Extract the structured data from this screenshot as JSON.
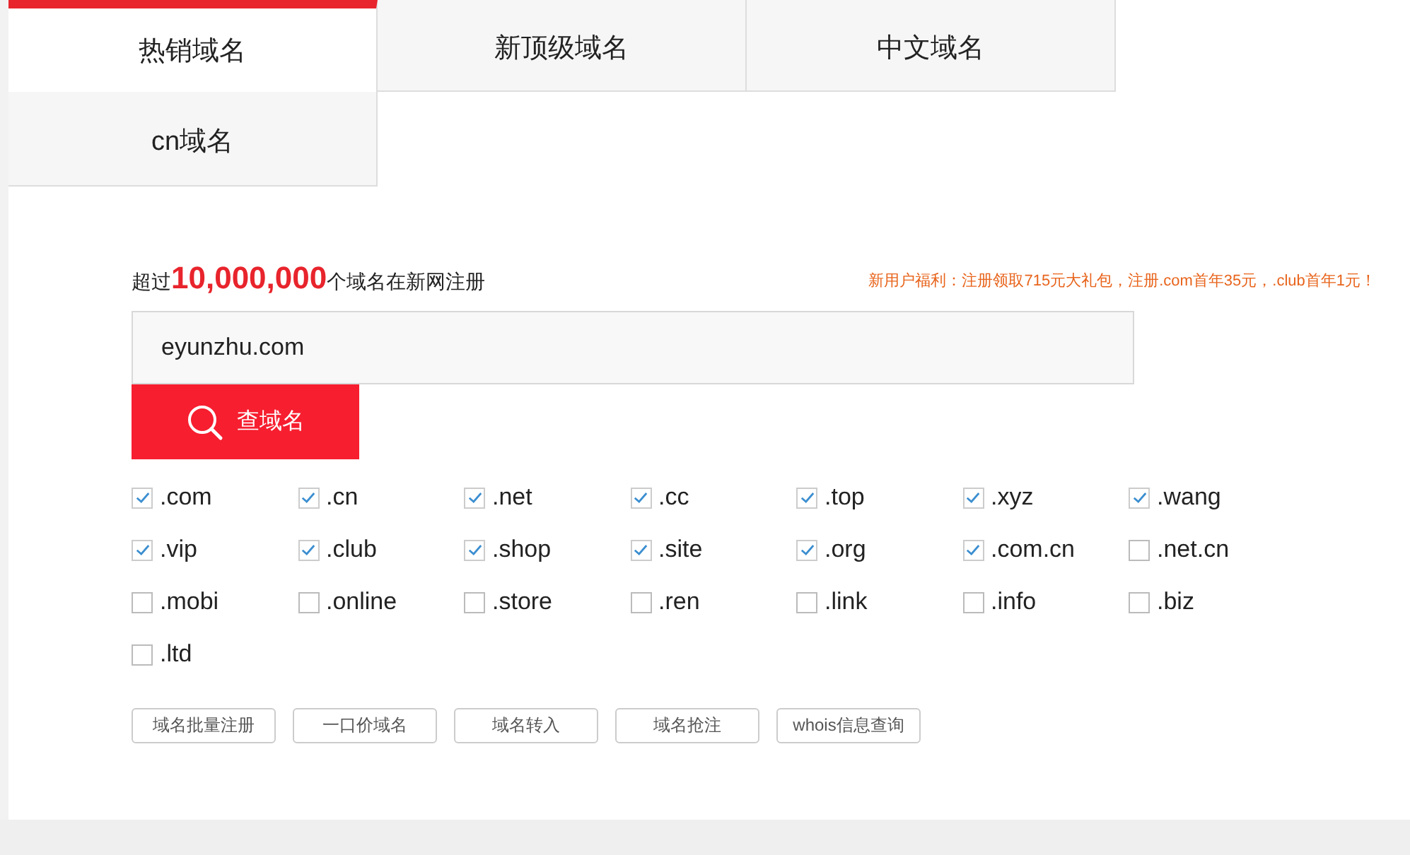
{
  "tabs": [
    {
      "label": "热销域名",
      "selected": true
    },
    {
      "label": "新顶级域名",
      "selected": false
    },
    {
      "label": "中文域名",
      "selected": false
    },
    {
      "label": "cn域名",
      "selected": false
    }
  ],
  "headline": "超过**10,000,000**个域名在新网注册",
  "promo": "新用户福利：注册领取715元大礼包，注册.com首年35元，.club首年1元！",
  "search": {
    "value": "eyunzhu.com",
    "button": "查域名"
  },
  "suffixes": [
    {
      "label": ".com",
      "checked": true
    },
    {
      "label": ".cn",
      "checked": true
    },
    {
      "label": ".net",
      "checked": true
    },
    {
      "label": ".cc",
      "checked": true
    },
    {
      "label": ".top",
      "checked": true
    },
    {
      "label": ".xyz",
      "checked": true
    },
    {
      "label": ".wang",
      "checked": true
    },
    {
      "label": ".vip",
      "checked": true
    },
    {
      "label": ".club",
      "checked": true
    },
    {
      "label": ".shop",
      "checked": true
    },
    {
      "label": ".site",
      "checked": true
    },
    {
      "label": ".org",
      "checked": true
    },
    {
      "label": ".com.cn",
      "checked": true
    },
    {
      "label": ".net.cn",
      "checked": false
    },
    {
      "label": ".mobi",
      "checked": false
    },
    {
      "label": ".online",
      "checked": false
    },
    {
      "label": ".store",
      "checked": false
    },
    {
      "label": ".ren",
      "checked": false
    },
    {
      "label": ".link",
      "checked": false
    },
    {
      "label": ".info",
      "checked": false
    },
    {
      "label": ".biz",
      "checked": false
    },
    {
      "label": ".ltd",
      "checked": false
    }
  ],
  "links": [
    "域名批量注册",
    "一口价域名",
    "域名转入",
    "域名抢注",
    "whois信息查询"
  ]
}
